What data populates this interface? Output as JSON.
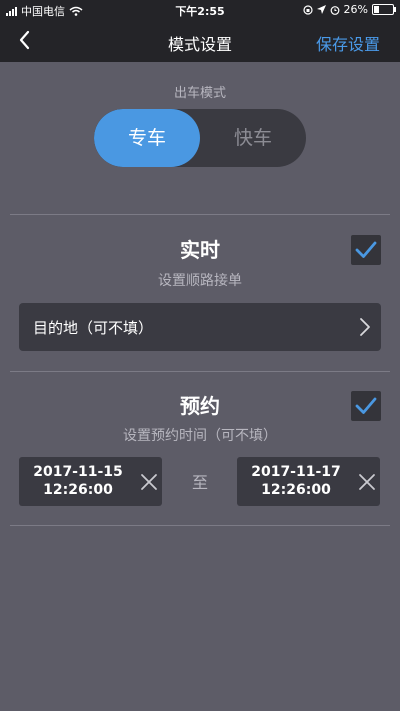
{
  "status_bar": {
    "carrier": "中国电信",
    "time": "下午2:55",
    "battery_text": "26%",
    "battery_level": 0.26
  },
  "nav": {
    "title": "模式设置",
    "save_label": "保存设置"
  },
  "mode": {
    "label": "出车模式",
    "options": [
      "专车",
      "快车"
    ],
    "selected": "专车"
  },
  "realtime": {
    "title": "实时",
    "subtitle": "设置顺路接单",
    "checked": true,
    "destination_placeholder": "目的地（可不填）"
  },
  "reservation": {
    "title": "预约",
    "subtitle": "设置预约时间（可不填）",
    "checked": true,
    "start_date": "2017-11-15",
    "start_time": "12:26:00",
    "separator": "至",
    "end_date": "2017-11-17",
    "end_time": "12:26:00"
  },
  "colors": {
    "accent": "#4a98e2",
    "background": "#5d5c67",
    "bar": "#242428"
  }
}
